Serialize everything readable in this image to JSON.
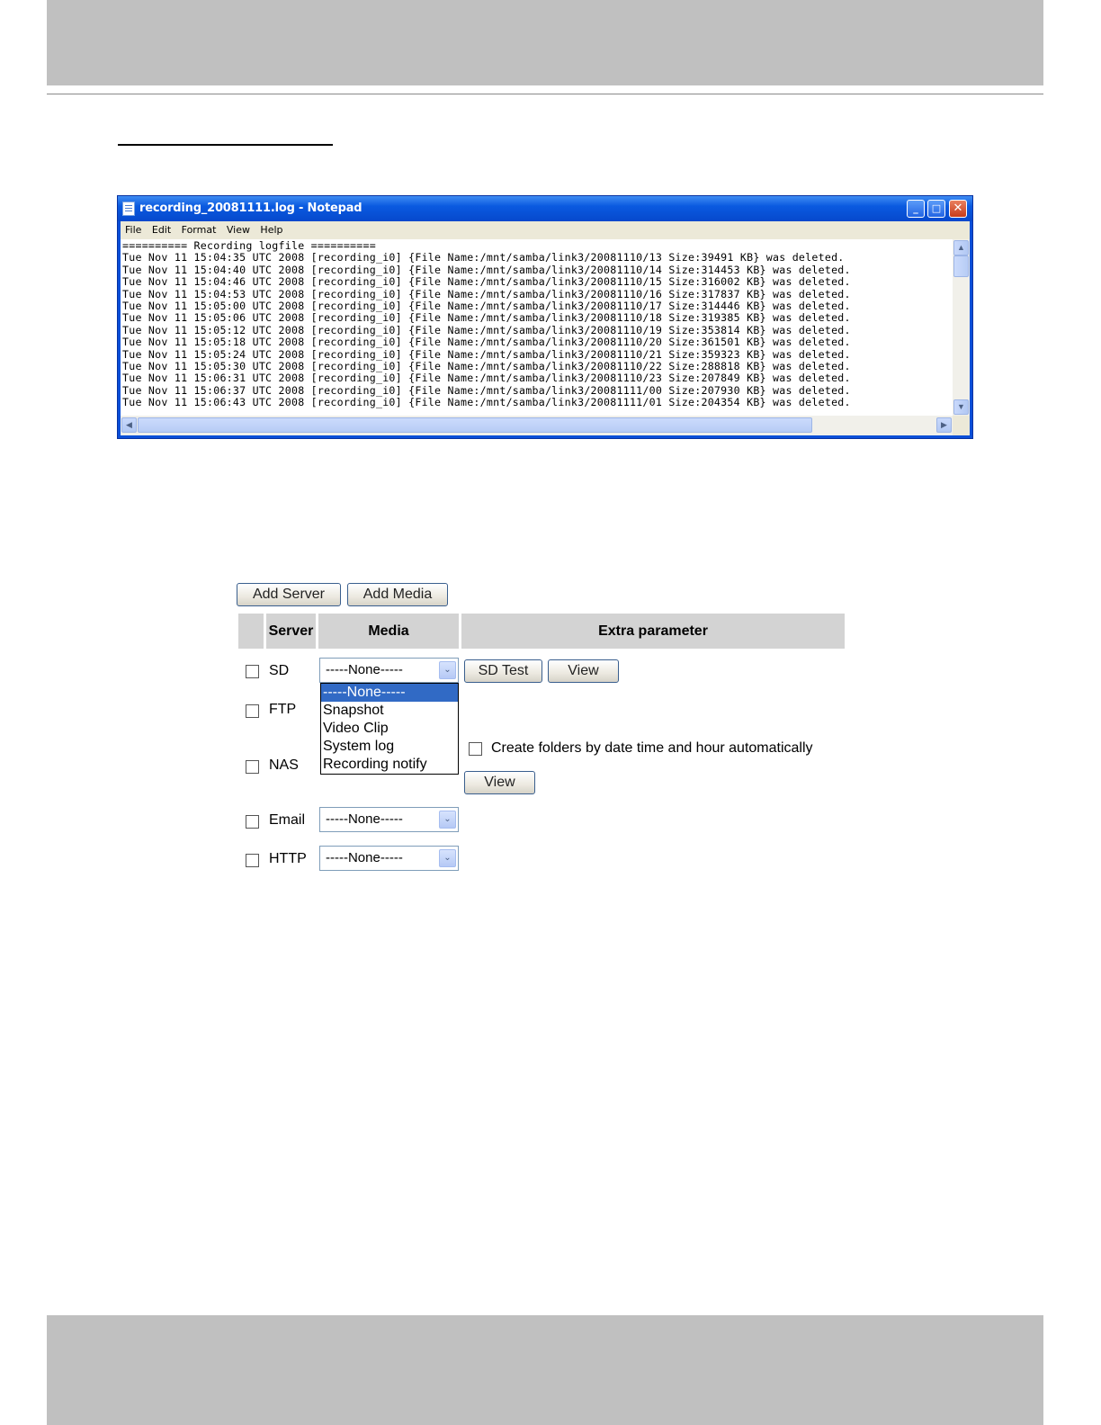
{
  "notepad": {
    "title": "recording_20081111.log - Notepad",
    "minimize": "_",
    "maximize": "□",
    "close": "✕",
    "menu": [
      "File",
      "Edit",
      "Format",
      "View",
      "Help"
    ],
    "log_text": "========== Recording logfile ==========\nTue Nov 11 15:04:35 UTC 2008 [recording_i0] {File Name:/mnt/samba/link3/20081110/13 Size:39491 KB} was deleted.\nTue Nov 11 15:04:40 UTC 2008 [recording_i0] {File Name:/mnt/samba/link3/20081110/14 Size:314453 KB} was deleted.\nTue Nov 11 15:04:46 UTC 2008 [recording_i0] {File Name:/mnt/samba/link3/20081110/15 Size:316002 KB} was deleted.\nTue Nov 11 15:04:53 UTC 2008 [recording_i0] {File Name:/mnt/samba/link3/20081110/16 Size:317837 KB} was deleted.\nTue Nov 11 15:05:00 UTC 2008 [recording_i0] {File Name:/mnt/samba/link3/20081110/17 Size:314446 KB} was deleted.\nTue Nov 11 15:05:06 UTC 2008 [recording_i0] {File Name:/mnt/samba/link3/20081110/18 Size:319385 KB} was deleted.\nTue Nov 11 15:05:12 UTC 2008 [recording_i0] {File Name:/mnt/samba/link3/20081110/19 Size:353814 KB} was deleted.\nTue Nov 11 15:05:18 UTC 2008 [recording_i0] {File Name:/mnt/samba/link3/20081110/20 Size:361501 KB} was deleted.\nTue Nov 11 15:05:24 UTC 2008 [recording_i0] {File Name:/mnt/samba/link3/20081110/21 Size:359323 KB} was deleted.\nTue Nov 11 15:05:30 UTC 2008 [recording_i0] {File Name:/mnt/samba/link3/20081110/22 Size:288818 KB} was deleted.\nTue Nov 11 15:06:31 UTC 2008 [recording_i0] {File Name:/mnt/samba/link3/20081110/23 Size:207849 KB} was deleted.\nTue Nov 11 15:06:37 UTC 2008 [recording_i0] {File Name:/mnt/samba/link3/20081111/00 Size:207930 KB} was deleted.\nTue Nov 11 15:06:43 UTC 2008 [recording_i0] {File Name:/mnt/samba/link3/20081111/01 Size:204354 KB} was deleted."
  },
  "media_panel": {
    "add_server": "Add Server",
    "add_media": "Add Media",
    "headers": {
      "server": "Server",
      "media": "Media",
      "extra": "Extra parameter"
    },
    "rows": {
      "sd": {
        "label": "SD",
        "media": "-----None-----",
        "test_button": "SD Test",
        "view_button": "View"
      },
      "ftp": {
        "label": "FTP"
      },
      "nas": {
        "label": "NAS",
        "folders_option": "Create folders by date time and hour automatically",
        "view_button": "View"
      },
      "email": {
        "label": "Email",
        "media": "-----None-----"
      },
      "http": {
        "label": "HTTP",
        "media": "-----None-----"
      }
    },
    "dropdown_options": [
      "-----None-----",
      "Snapshot",
      "Video Clip",
      "System log",
      "Recording notify"
    ],
    "dropdown_selected": "-----None-----"
  },
  "icons": {
    "select_arrow": "⌄",
    "scroll_up": "▲",
    "scroll_down": "▼",
    "scroll_left": "◀",
    "scroll_right": "▶"
  },
  "colors": {
    "title_bar": "#0a5ae0",
    "highlight": "#316ac5",
    "header_gray": "#d3d3d3"
  }
}
